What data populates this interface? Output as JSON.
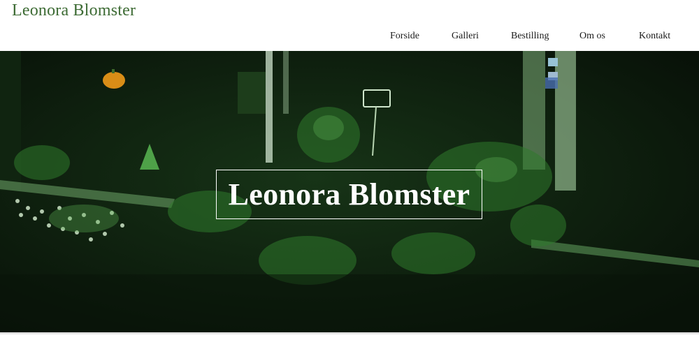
{
  "site": {
    "logo_text": "Leonora Blomster"
  },
  "nav": {
    "items": [
      {
        "label": "Forside"
      },
      {
        "label": "Galleri"
      },
      {
        "label": "Bestilling"
      },
      {
        "label": "Om os"
      },
      {
        "label": "Kontakt"
      }
    ]
  },
  "hero": {
    "title": "Leonora Blomster"
  },
  "colors": {
    "logo": "#3d6b34",
    "hero_background": "#0b150c",
    "foliage": "#2f7a2c",
    "title": "#ffffff"
  }
}
